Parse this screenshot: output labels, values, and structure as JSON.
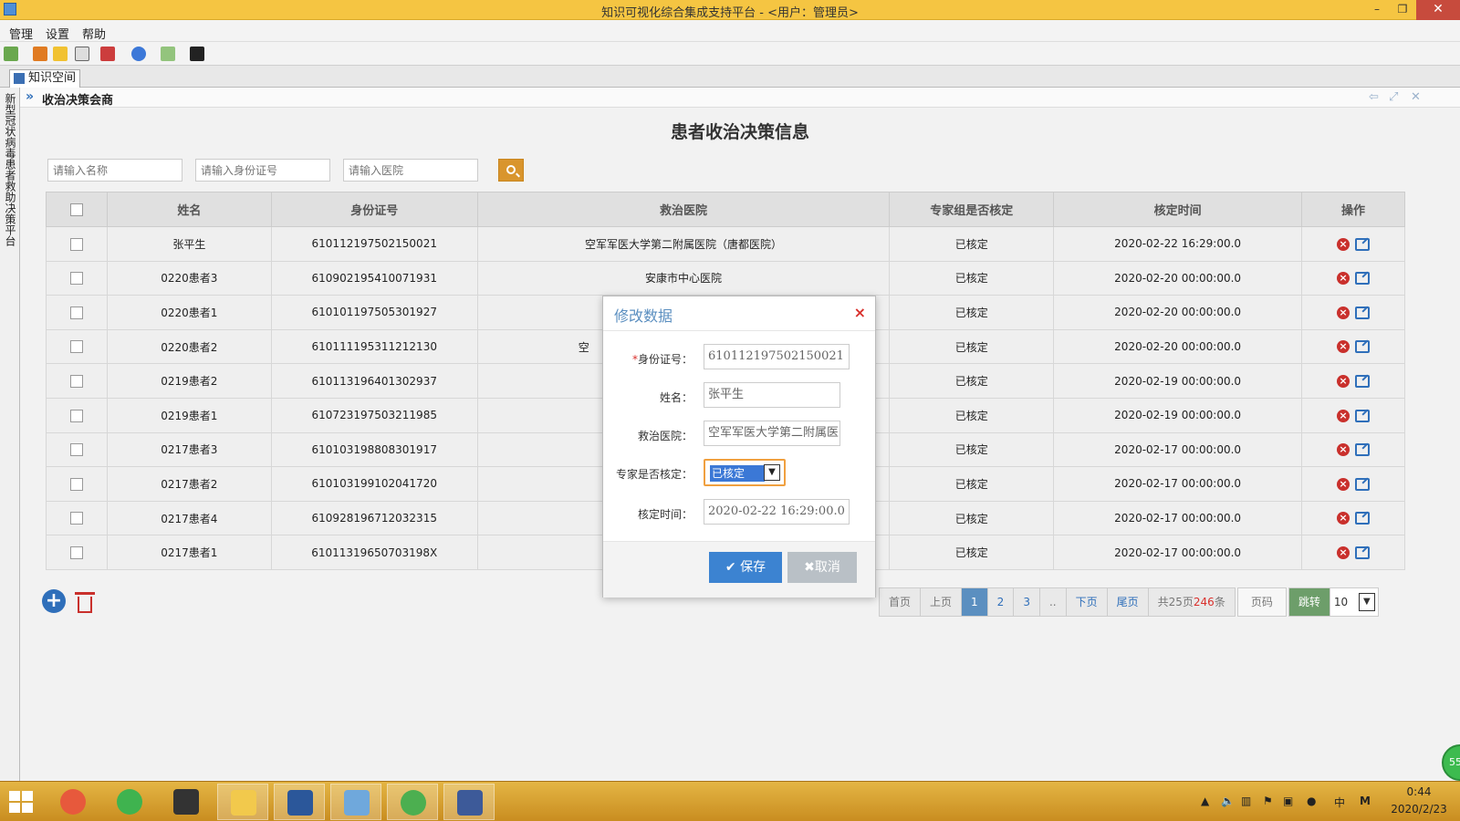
{
  "window": {
    "title": "知识可视化综合集成支持平台 - <用户：管理员>",
    "min_icon": "minimize-icon",
    "max_icon": "maximize-icon",
    "close_icon": "close-icon"
  },
  "menu": {
    "items": [
      "管理",
      "设置",
      "帮助"
    ]
  },
  "toolbar": {
    "icons": [
      "exit-icon",
      "rss-icon",
      "folder-icon",
      "document-icon",
      "tools-icon",
      "user-icon",
      "package-icon",
      "camera-icon"
    ]
  },
  "tab": {
    "label": "知识空间"
  },
  "rail": {
    "label": "新型冠状病毒患者救助决策平台"
  },
  "panel": {
    "title": "收治决策会商"
  },
  "page": {
    "title": "患者收治决策信息"
  },
  "search": {
    "name_placeholder": "请输入名称",
    "id_placeholder": "请输入身份证号",
    "hospital_placeholder": "请输入医院"
  },
  "table": {
    "headers": [
      "姓名",
      "身份证号",
      "救治医院",
      "专家组是否核定",
      "核定时间",
      "操作"
    ],
    "rows": [
      {
        "name": "张平生",
        "id": "610112197502150021",
        "hospital": "空军军医大学第二附属医院（唐都医院）",
        "verified": "已核定",
        "time": "2020-02-22 16:29:00.0"
      },
      {
        "name": "0220患者3",
        "id": "610902195410071931",
        "hospital": "安康市中心医院",
        "verified": "已核定",
        "time": "2020-02-20 00:00:00.0"
      },
      {
        "name": "0220患者1",
        "id": "610101197505301927",
        "hospital": "",
        "verified": "已核定",
        "time": "2020-02-20 00:00:00.0"
      },
      {
        "name": "0220患者2",
        "id": "610111195311212130",
        "hospital": "空",
        "verified": "已核定",
        "time": "2020-02-20 00:00:00.0"
      },
      {
        "name": "0219患者2",
        "id": "610113196401302937",
        "hospital": "",
        "verified": "已核定",
        "time": "2020-02-19 00:00:00.0"
      },
      {
        "name": "0219患者1",
        "id": "610723197503211985",
        "hospital": "",
        "verified": "已核定",
        "time": "2020-02-19 00:00:00.0"
      },
      {
        "name": "0217患者3",
        "id": "610103198808301917",
        "hospital": "",
        "verified": "已核定",
        "time": "2020-02-17 00:00:00.0"
      },
      {
        "name": "0217患者2",
        "id": "610103199102041720",
        "hospital": "",
        "verified": "已核定",
        "time": "2020-02-17 00:00:00.0"
      },
      {
        "name": "0217患者4",
        "id": "610928196712032315",
        "hospital": "",
        "verified": "已核定",
        "time": "2020-02-17 00:00:00.0"
      },
      {
        "name": "0217患者1",
        "id": "61011319650703198X",
        "hospital": "",
        "verified": "已核定",
        "time": "2020-02-17 00:00:00.0"
      }
    ]
  },
  "pager": {
    "first": "首页",
    "prev": "上页",
    "pages": [
      "1",
      "2",
      "3",
      ".."
    ],
    "next": "下页",
    "last": "尾页",
    "info_prefix": "共25页",
    "info_count": "246",
    "info_suffix": "条",
    "page_input": "页码",
    "jump": "跳转",
    "page_size": "10"
  },
  "modal": {
    "title": "修改数据",
    "id_label": "身份证号：",
    "id_required_mark": "*",
    "id_value": "610112197502150021",
    "name_label": "姓名：",
    "name_value": "张平生",
    "hospital_label": "救治医院：",
    "hospital_value": "空军军医大学第二附属医院",
    "verified_label": "专家是否核定：",
    "verified_value": "已核定",
    "time_label": "核定时间：",
    "time_value": "2020-02-22 16:29:00.0",
    "save_label": "保存",
    "cancel_label": "取消"
  },
  "badge": {
    "text": "55"
  },
  "taskbar": {
    "tray_ime": "中",
    "tray_m": "M",
    "time": "0:44",
    "date": "2020/2/23"
  },
  "colors": {
    "titlebar": "#f5c542",
    "accent_blue": "#3c83d1",
    "delete_red": "#c9302c",
    "search_button": "#d9952d",
    "jump_green": "#6d9e6a"
  }
}
